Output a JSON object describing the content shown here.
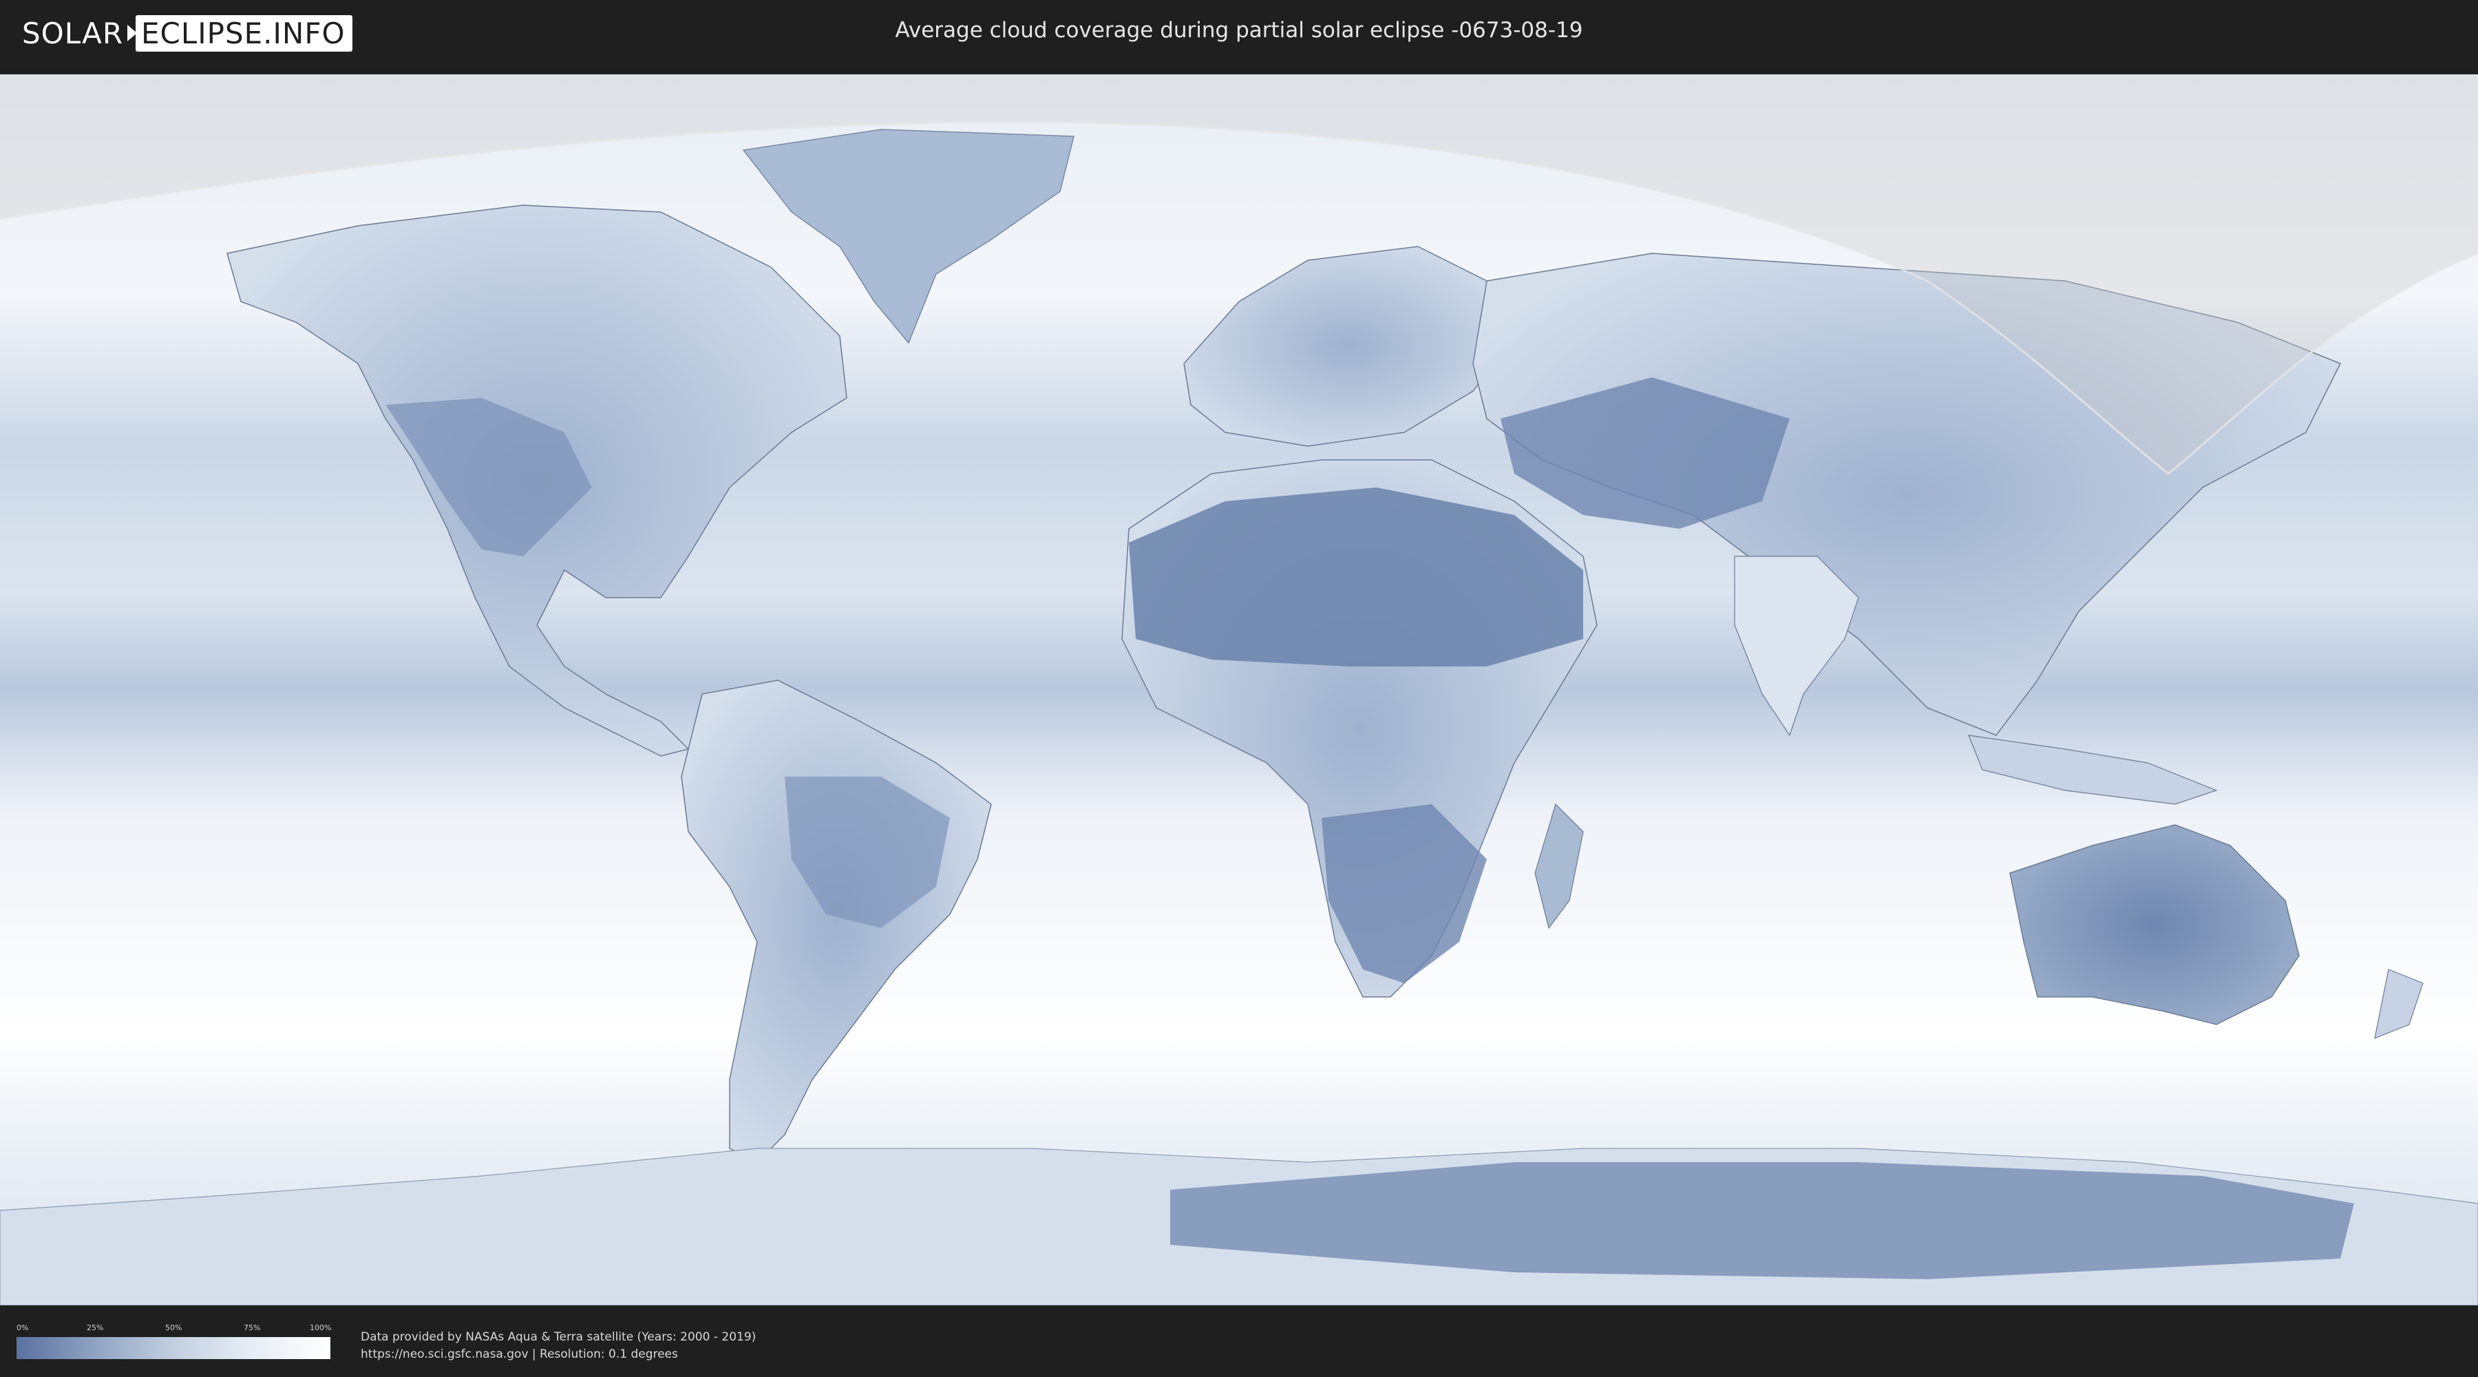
{
  "header": {
    "logo_part1": "SOLAR",
    "logo_part2": "ECLIPSE.INFO",
    "title": "Average cloud coverage during partial solar eclipse -0673-08-19"
  },
  "map": {
    "colors": {
      "clear_sky": "#5a71a0",
      "cloudy": "#ffffff",
      "ocean_base": "#dfe7f1",
      "eclipse_overlay": "#c8c8c8",
      "borders": "#6b7b93"
    }
  },
  "legend": {
    "tick_labels": [
      "0%",
      "25%",
      "50%",
      "75%",
      "100%"
    ],
    "gradient": [
      "#5a71a0",
      "#8fa3c3",
      "#c3cfe0",
      "#e6edf5",
      "#ffffff"
    ]
  },
  "footer": {
    "credit_line1": "Data provided by NASAs Aqua & Terra satellite (Years: 2000 - 2019)",
    "credit_line2": "https://neo.sci.gsfc.nasa.gov | Resolution: 0.1 degrees"
  }
}
